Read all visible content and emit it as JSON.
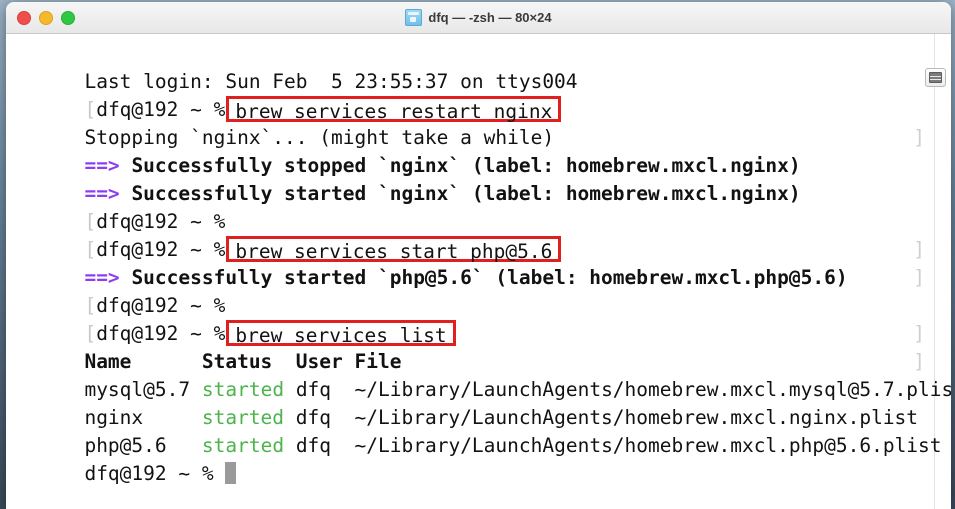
{
  "window": {
    "title": "dfq — -zsh — 80×24",
    "icon": "terminal-folder-icon",
    "traffic_lights": [
      {
        "name": "close",
        "color": "#ef4f4a"
      },
      {
        "name": "minimize",
        "color": "#f5b92c"
      },
      {
        "name": "zoom",
        "color": "#30c840"
      }
    ],
    "pane_button_icon": "split-pane-icon"
  },
  "colors": {
    "highlight_box": "#e01f1f",
    "arrow_prefix": "#8b3ff5",
    "status_started": "#4cb44c",
    "text": "#121212",
    "cursor": "#9a9a9a"
  },
  "terminal": {
    "prompt": "dfq@192 ~ %",
    "bracket_open": "[",
    "bracket_close": "]",
    "lines": [
      {
        "id": "last-login",
        "text": "Last login: Sun Feb  5 23:55:37 on ttys004"
      },
      {
        "id": "cmd-restart-nginx",
        "command": "brew services restart nginx"
      },
      {
        "id": "stopping-nginx",
        "text": "Stopping `nginx`... (might take a while)"
      },
      {
        "id": "stopped-nginx",
        "arrow": "==>",
        "text": "Successfully stopped `nginx` (label: homebrew.mxcl.nginx)"
      },
      {
        "id": "started-nginx",
        "arrow": "==>",
        "text": "Successfully started `nginx` (label: homebrew.mxcl.nginx)"
      },
      {
        "id": "blank-prompt-1",
        "command": ""
      },
      {
        "id": "cmd-start-php",
        "command": "brew services start php@5.6"
      },
      {
        "id": "started-php",
        "arrow": "==>",
        "text": "Successfully started `php@5.6` (label: homebrew.mxcl.php@5.6)"
      },
      {
        "id": "blank-prompt-2",
        "command": ""
      },
      {
        "id": "cmd-services-list",
        "command": "brew services list"
      }
    ],
    "table": {
      "headers": [
        "Name",
        "Status",
        "User",
        "File"
      ],
      "header_line": "Name      Status  User File",
      "rows": [
        {
          "name": "mysql@5.7",
          "status": "started",
          "user": "dfq",
          "file": "~/Library/LaunchAgents/homebrew.mxcl.mysql@5.7.plist"
        },
        {
          "name": "nginx",
          "status": "started",
          "user": "dfq",
          "file": "~/Library/LaunchAgents/homebrew.mxcl.nginx.plist"
        },
        {
          "name": "php@5.6",
          "status": "started",
          "user": "dfq",
          "file": "~/Library/LaunchAgents/homebrew.mxcl.php@5.6.plist"
        }
      ]
    },
    "final_prompt": "dfq@192 ~ %"
  }
}
